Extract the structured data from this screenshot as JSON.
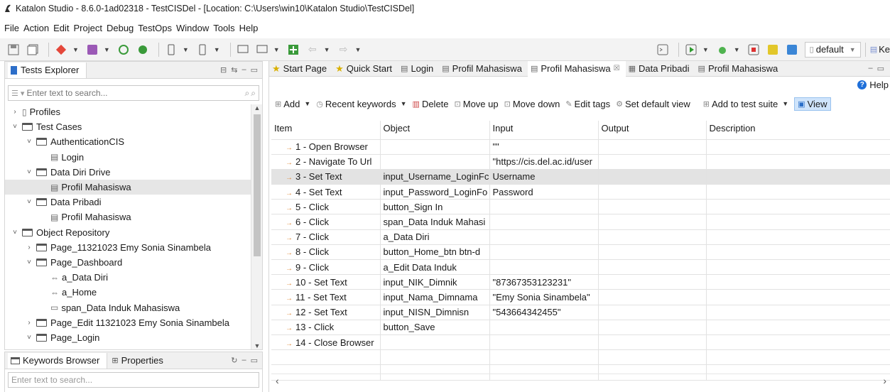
{
  "window": {
    "title": "Katalon Studio - 8.6.0-1ad02318 - TestCISDel - [Location: C:\\Users\\win10\\Katalon Studio\\TestCISDel]"
  },
  "menu": [
    "File",
    "Action",
    "Edit",
    "Project",
    "Debug",
    "TestOps",
    "Window",
    "Tools",
    "Help"
  ],
  "toolbar": {
    "profile": "default",
    "truncated_label": "Ke"
  },
  "tests_explorer": {
    "title": "Tests Explorer",
    "search_placeholder": "Enter text to search...",
    "tree": [
      {
        "label": "Profiles",
        "level": 0,
        "twisty": "›",
        "kind": "profile"
      },
      {
        "label": "Test Cases",
        "level": 0,
        "twisty": "˅",
        "kind": "folder"
      },
      {
        "label": "AuthenticationCIS",
        "level": 1,
        "twisty": "˅",
        "kind": "folder"
      },
      {
        "label": "Login",
        "level": 2,
        "twisty": "",
        "kind": "testcase"
      },
      {
        "label": "Data Diri Drive",
        "level": 1,
        "twisty": "˅",
        "kind": "folder"
      },
      {
        "label": "Profil Mahasiswa",
        "level": 2,
        "twisty": "",
        "kind": "testcase",
        "selected": true
      },
      {
        "label": "Data Pribadi",
        "level": 1,
        "twisty": "˅",
        "kind": "folder"
      },
      {
        "label": "Profil Mahasiswa",
        "level": 2,
        "twisty": "",
        "kind": "testcase"
      },
      {
        "label": "Object Repository",
        "level": 0,
        "twisty": "˅",
        "kind": "repo"
      },
      {
        "label": "Page_11321023 Emy Sonia Sinambela",
        "level": 1,
        "twisty": "›",
        "kind": "folder"
      },
      {
        "label": "Page_Dashboard",
        "level": 1,
        "twisty": "˅",
        "kind": "folder"
      },
      {
        "label": "a_Data Diri",
        "level": 2,
        "twisty": "",
        "kind": "link"
      },
      {
        "label": "a_Home",
        "level": 2,
        "twisty": "",
        "kind": "link"
      },
      {
        "label": "span_Data Induk Mahasiswa",
        "level": 2,
        "twisty": "",
        "kind": "span"
      },
      {
        "label": "Page_Edit 11321023 Emy Sonia Sinambela",
        "level": 1,
        "twisty": "›",
        "kind": "folder"
      },
      {
        "label": "Page_Login",
        "level": 1,
        "twisty": "˅",
        "kind": "folder"
      }
    ]
  },
  "bottom_panel": {
    "tab1": "Keywords Browser",
    "tab2": "Properties",
    "search_placeholder": "Enter text to search..."
  },
  "editor": {
    "tabs": [
      {
        "label": "Start Page",
        "icon": "star-icon"
      },
      {
        "label": "Quick Start",
        "icon": "star-icon"
      },
      {
        "label": "Login",
        "icon": "testcase-icon"
      },
      {
        "label": "Profil Mahasiswa",
        "icon": "testcase-icon"
      },
      {
        "label": "Profil Mahasiswa",
        "icon": "testcase-icon",
        "active": true,
        "close": "☒"
      },
      {
        "label": "Data Pribadi",
        "icon": "data-icon"
      },
      {
        "label": "Profil Mahasiswa",
        "icon": "testcase-icon"
      }
    ],
    "help": "Help",
    "actions": {
      "add": "Add",
      "recent": "Recent keywords",
      "delete": "Delete",
      "move_up": "Move up",
      "move_down": "Move down",
      "edit_tags": "Edit tags",
      "set_default": "Set default view",
      "add_suite": "Add to test suite",
      "view": "View"
    },
    "columns": [
      "Item",
      "Object",
      "Input",
      "Output",
      "Description"
    ],
    "rows": [
      {
        "item": "1 - Open Browser",
        "object": "",
        "input": "\"\"",
        "output": "",
        "description": ""
      },
      {
        "item": "2 - Navigate To Url",
        "object": "",
        "input": "\"https://cis.del.ac.id/user",
        "output": "",
        "description": ""
      },
      {
        "item": "3 - Set Text",
        "object": "input_Username_LoginFc",
        "input": "Username",
        "output": "",
        "description": "",
        "selected": true
      },
      {
        "item": "4 - Set Text",
        "object": "input_Password_LoginFo",
        "input": "Password",
        "output": "",
        "description": ""
      },
      {
        "item": "5 - Click",
        "object": "button_Sign In",
        "input": "",
        "output": "",
        "description": ""
      },
      {
        "item": "6 - Click",
        "object": "span_Data Induk Mahasi",
        "input": "",
        "output": "",
        "description": ""
      },
      {
        "item": "7 - Click",
        "object": "a_Data Diri",
        "input": "",
        "output": "",
        "description": ""
      },
      {
        "item": "8 - Click",
        "object": "button_Home_btn btn-d",
        "input": "",
        "output": "",
        "description": ""
      },
      {
        "item": "9 - Click",
        "object": "a_Edit Data Induk",
        "input": "",
        "output": "",
        "description": ""
      },
      {
        "item": "10 - Set Text",
        "object": "input_NIK_Dimnik",
        "input": "\"87367353123231\"",
        "output": "",
        "description": ""
      },
      {
        "item": "11 - Set Text",
        "object": "input_Nama_Dimnama",
        "input": "\"Emy Sonia Sinambela\"",
        "output": "",
        "description": ""
      },
      {
        "item": "12 - Set Text",
        "object": "input_NISN_Dimnisn",
        "input": "\"543664342455\"",
        "output": "",
        "description": ""
      },
      {
        "item": "13 - Click",
        "object": "button_Save",
        "input": "",
        "output": "",
        "description": ""
      },
      {
        "item": "14 - Close Browser",
        "object": "",
        "input": "",
        "output": "",
        "description": ""
      },
      {
        "item": "",
        "object": "",
        "input": "",
        "output": "",
        "description": ""
      },
      {
        "item": "",
        "object": "",
        "input": "",
        "output": "",
        "description": ""
      }
    ]
  }
}
